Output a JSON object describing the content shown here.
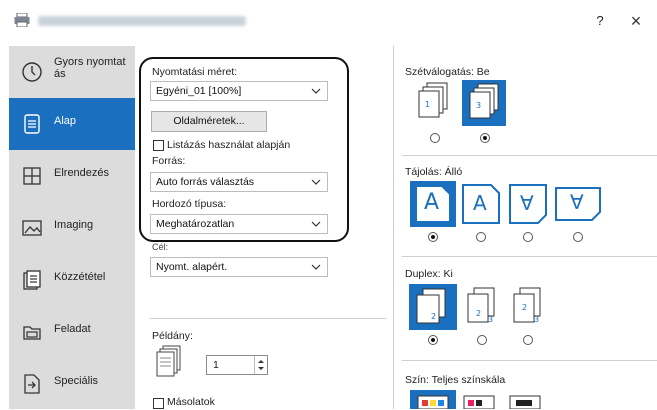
{
  "window": {
    "help_label": "?",
    "close_label": "×"
  },
  "sidebar": {
    "items": [
      {
        "label_line1": "Gyors nyomtat",
        "label_line2": "ás",
        "icon": "clock-icon"
      },
      {
        "label": "Alap",
        "icon": "document-icon",
        "active": true
      },
      {
        "label": "Elrendezés",
        "icon": "grid-icon"
      },
      {
        "label": "Imaging",
        "icon": "picture-icon"
      },
      {
        "label": "Közzététel",
        "icon": "publish-icon"
      },
      {
        "label": "Feladat",
        "icon": "job-icon"
      },
      {
        "label": "Speciális",
        "icon": "advanced-icon"
      }
    ]
  },
  "basic": {
    "print_size_label": "Nyomtatási méret:",
    "print_size_value": "Egyéni_01 [100%]",
    "page_sizes_button": "Oldalméretek...",
    "list_based_label": "Listázás használat alapján",
    "source_label": "Forrás:",
    "source_value": "Auto forrás választás",
    "media_type_label": "Hordozó típusa:",
    "media_type_value": "Meghatározatlan",
    "cut_label": "Cél:",
    "dest_value": "Nyomt. alapért.",
    "copies_label": "Példány:",
    "copies_value": "1",
    "collate_chk_label": "Másolatok"
  },
  "right": {
    "collate_label": "Szétválogatás:  Be",
    "orientation_label": "Tájolás:  Álló",
    "orientation_glyphs": [
      "A",
      "A",
      "∀",
      "∀"
    ],
    "duplex_label": "Duplex:  Ki",
    "color_label": "Szín:  Teljes színskála"
  },
  "colors": {
    "accent": "#1a6fbf"
  }
}
